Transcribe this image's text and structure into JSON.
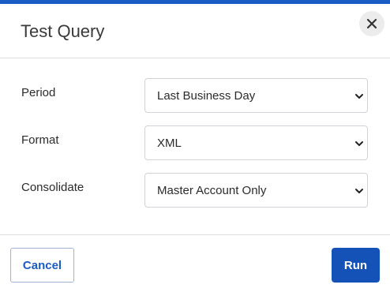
{
  "dialog": {
    "title": "Test Query",
    "close_icon": "close-icon"
  },
  "fields": [
    {
      "label": "Period",
      "value": "Last Business Day"
    },
    {
      "label": "Format",
      "value": "XML"
    },
    {
      "label": "Consolidate",
      "value": "Master Account Only"
    }
  ],
  "footer": {
    "cancel_label": "Cancel",
    "run_label": "Run"
  },
  "colors": {
    "accent": "#1a5bc4",
    "primary_button": "#1452b8"
  }
}
